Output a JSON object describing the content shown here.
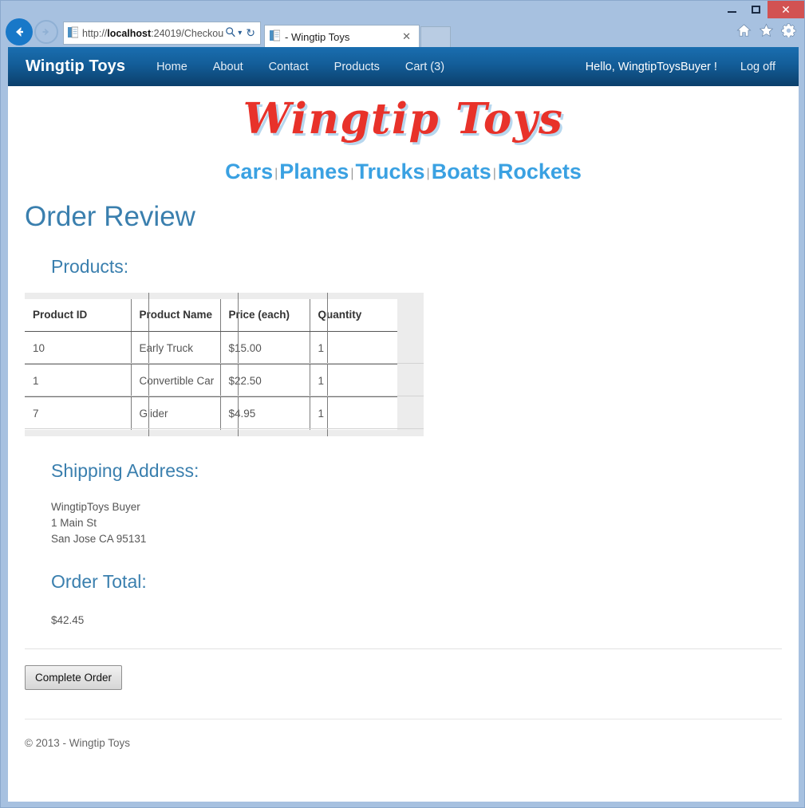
{
  "browser": {
    "window_controls": {
      "minimize": "–",
      "maximize": "□",
      "close": "✕"
    },
    "back_icon": "back-arrow-icon",
    "forward_icon": "forward-arrow-icon",
    "address": {
      "url_protocol_path": "http://",
      "url_host": "localhost",
      "url_rest": ":24019/Checkou",
      "search_icon": "search-icon",
      "dropdown_icon": "▾",
      "refresh_icon": "↻"
    },
    "tab": {
      "title": "- Wingtip Toys",
      "close": "✕"
    },
    "toolbar_icons": [
      "home-icon",
      "favorites-star-icon",
      "settings-gear-icon"
    ]
  },
  "navbar": {
    "brand": "Wingtip Toys",
    "links": [
      {
        "label": "Home"
      },
      {
        "label": "About"
      },
      {
        "label": "Contact"
      },
      {
        "label": "Products"
      },
      {
        "label": "Cart (3)"
      }
    ],
    "greeting": "Hello, WingtipToysBuyer !",
    "logoff": "Log off"
  },
  "header": {
    "logo_text": "Wingtip Toys",
    "categories": [
      "Cars",
      "Planes",
      "Trucks",
      "Boats",
      "Rockets"
    ],
    "separator": "|"
  },
  "page": {
    "title": "Order Review",
    "products_heading": "Products:",
    "shipping_heading": "Shipping Address:",
    "total_heading": "Order Total:",
    "total_amount": "$42.45",
    "complete_order_label": "Complete Order",
    "footer": "© 2013 - Wingtip Toys"
  },
  "products_table": {
    "columns": [
      "Product ID",
      "Product Name",
      "Price (each)",
      "Quantity"
    ],
    "rows": [
      {
        "id": "10",
        "name": "Early Truck",
        "price": "$15.00",
        "qty": "1"
      },
      {
        "id": "1",
        "name": "Convertible Car",
        "price": "$22.50",
        "qty": "1"
      },
      {
        "id": "7",
        "name": "Glider",
        "price": "$4.95",
        "qty": "1"
      }
    ]
  },
  "shipping_address": {
    "lines": [
      "WingtipToys Buyer",
      "1 Main St",
      "San Jose CA 95131"
    ]
  },
  "colors": {
    "navbar_top": "#1a6eb0",
    "navbar_bottom": "#0b3f6b",
    "heading_blue": "#3a7fae",
    "category_blue": "#3aa1e2",
    "logo_red": "#e8322a",
    "logo_shadow_blue": "#b7d7ee",
    "window_frame": "#a7c1e0",
    "table_panel_gray": "#ececec",
    "close_button_red": "#d25252"
  }
}
